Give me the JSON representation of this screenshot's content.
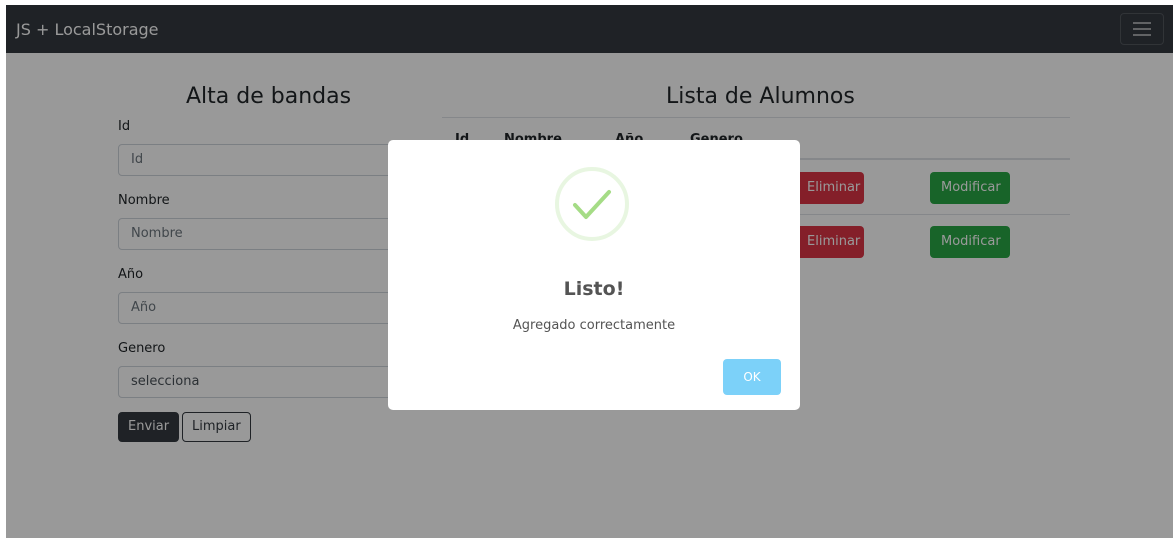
{
  "navbar": {
    "brand": "JS + LocalStorage",
    "menu_icon": "hamburger-icon"
  },
  "form": {
    "title": "Alta de bandas",
    "fields": [
      {
        "label": "Id",
        "placeholder": "Id"
      },
      {
        "label": "Nombre",
        "placeholder": "Nombre"
      },
      {
        "label": "Año",
        "placeholder": "Año"
      },
      {
        "label": "Genero",
        "value": "selecciona"
      }
    ],
    "submit_label": "Enviar",
    "clear_label": "Limpiar"
  },
  "list": {
    "title": "Lista de Alumnos",
    "headers": [
      "Id",
      "Nombre",
      "Año",
      "Genero"
    ],
    "rows": [
      {
        "delete_label": "Eliminar",
        "edit_label": "Modificar"
      },
      {
        "delete_label": "Eliminar",
        "edit_label": "Modificar"
      }
    ]
  },
  "modal": {
    "icon": "checkmark-icon",
    "title": "Listo!",
    "text": "Agregado correctamente",
    "ok_label": "OK"
  },
  "colors": {
    "navbar_bg": "#343a40",
    "danger": "#dc3545",
    "success": "#28a745",
    "ok_button": "#7cd1f9",
    "check": "#a5dc86"
  }
}
